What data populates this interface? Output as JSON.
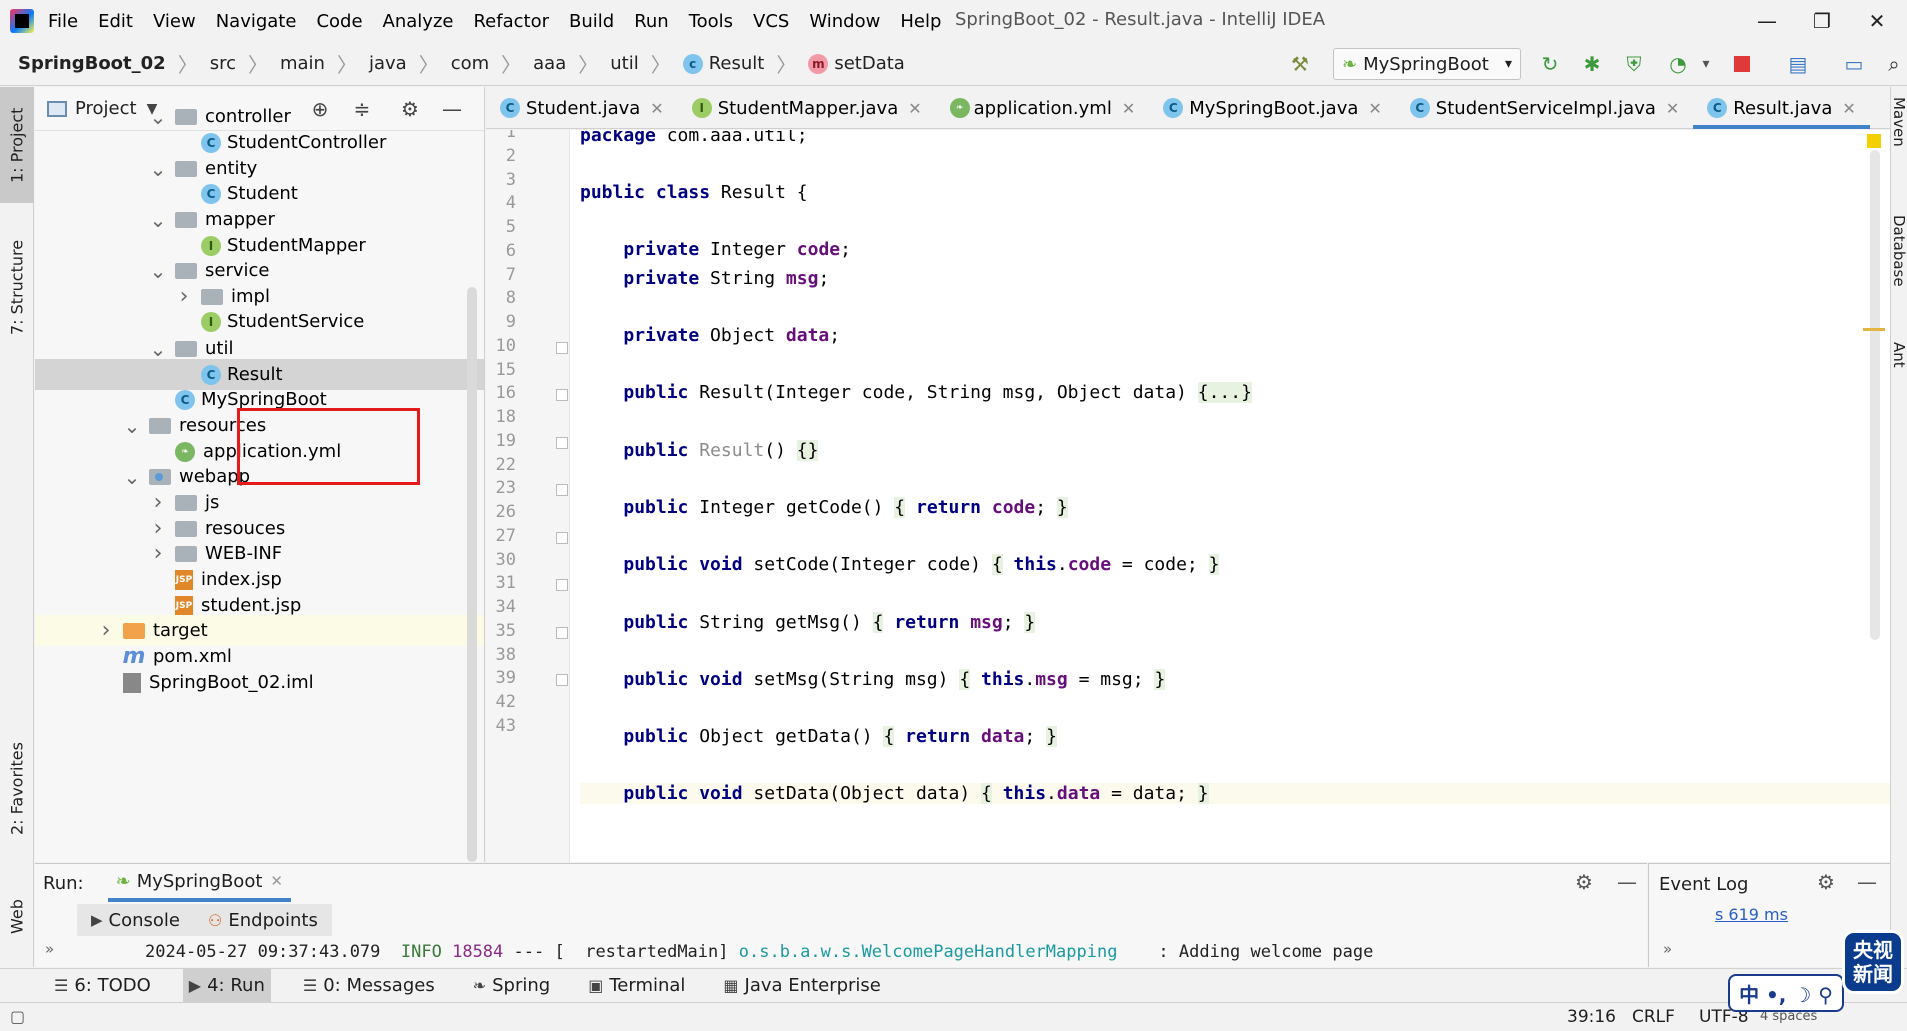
{
  "menubar": {
    "items": [
      "File",
      "Edit",
      "View",
      "Navigate",
      "Code",
      "Analyze",
      "Refactor",
      "Build",
      "Run",
      "Tools",
      "VCS",
      "Window",
      "Help"
    ],
    "window_title": "SpringBoot_02 - Result.java - IntelliJ IDEA"
  },
  "breadcrumb": {
    "items": [
      "SpringBoot_02",
      "src",
      "main",
      "java",
      "com",
      "aaa",
      "util",
      "Result",
      "setData"
    ]
  },
  "toolbar": {
    "run_config": "MySpringBoot"
  },
  "left_strip": {
    "project_tab": "1: Project",
    "structure_tab": "7: Structure",
    "favorites_tab": "2: Favorites",
    "web_tab": "Web"
  },
  "right_strip": {
    "maven_tab": "Maven",
    "database_tab": "Database",
    "ant_tab": "Ant"
  },
  "project_panel": {
    "title": "Project",
    "tree": [
      {
        "label": "controller",
        "type": "folder",
        "indent": 1,
        "arrow": "down"
      },
      {
        "label": "StudentController",
        "type": "class",
        "indent": 2,
        "arrow": ""
      },
      {
        "label": "entity",
        "type": "folder",
        "indent": 1,
        "arrow": "down"
      },
      {
        "label": "Student",
        "type": "class",
        "indent": 2,
        "arrow": ""
      },
      {
        "label": "mapper",
        "type": "folder",
        "indent": 1,
        "arrow": "down"
      },
      {
        "label": "StudentMapper",
        "type": "interface",
        "indent": 2,
        "arrow": ""
      },
      {
        "label": "service",
        "type": "folder",
        "indent": 1,
        "arrow": "down"
      },
      {
        "label": "impl",
        "type": "folder",
        "indent": 2,
        "arrow": "right"
      },
      {
        "label": "StudentService",
        "type": "interface",
        "indent": 2,
        "arrow": ""
      },
      {
        "label": "util",
        "type": "folder",
        "indent": 1,
        "arrow": "down"
      },
      {
        "label": "Result",
        "type": "class",
        "indent": 2,
        "arrow": "",
        "selected": true
      },
      {
        "label": "MySpringBoot",
        "type": "class",
        "indent": 1,
        "arrow": ""
      },
      {
        "label": "resources",
        "type": "folder",
        "indent": 0,
        "arrow": "down"
      },
      {
        "label": "application.yml",
        "type": "yml",
        "indent": 1,
        "arrow": ""
      },
      {
        "label": "webapp",
        "type": "folder-blue",
        "indent": 0,
        "arrow": "down"
      },
      {
        "label": "js",
        "type": "folder",
        "indent": 1,
        "arrow": "right"
      },
      {
        "label": "resouces",
        "type": "folder",
        "indent": 1,
        "arrow": "right"
      },
      {
        "label": "WEB-INF",
        "type": "folder",
        "indent": 1,
        "arrow": "right"
      },
      {
        "label": "index.jsp",
        "type": "jsp",
        "indent": 1,
        "arrow": ""
      },
      {
        "label": "student.jsp",
        "type": "jsp",
        "indent": 1,
        "arrow": ""
      },
      {
        "label": "target",
        "type": "folder-orange",
        "indent": -1,
        "arrow": "right",
        "yellow": true
      },
      {
        "label": "pom.xml",
        "type": "pom",
        "indent": -1,
        "arrow": ""
      },
      {
        "label": "SpringBoot_02.iml",
        "type": "iml",
        "indent": -1,
        "arrow": ""
      }
    ]
  },
  "editor_tabs": [
    {
      "label": "Student.java",
      "icon": "c"
    },
    {
      "label": "StudentMapper.java",
      "icon": "i"
    },
    {
      "label": "application.yml",
      "icon": "yml"
    },
    {
      "label": "MySpringBoot.java",
      "icon": "c"
    },
    {
      "label": "StudentServiceImpl.java",
      "icon": "c"
    },
    {
      "label": "Result.java",
      "icon": "c",
      "active": true
    }
  ],
  "editor": {
    "line_numbers": [
      "1",
      "2",
      "3",
      "4",
      "5",
      "6",
      "7",
      "8",
      "9",
      "10",
      "15",
      "16",
      "18",
      "19",
      "22",
      "23",
      "26",
      "27",
      "30",
      "31",
      "34",
      "35",
      "38",
      "39",
      "42",
      "43"
    ],
    "current_line": "39"
  },
  "run_panel": {
    "label": "Run:",
    "tab": "MySpringBoot",
    "console_tab": "Console",
    "endpoints_tab": "Endpoints",
    "console_line": {
      "timestamp": "2024-05-27 09:37:43.079",
      "level": "INFO",
      "pid": "18584",
      "sep": "--- [",
      "thread": "restartedMain]",
      "logger": "o.s.b.a.w.s.WelcomePageHandlerMapping",
      "message": ": Adding welcome page"
    }
  },
  "event_log": {
    "title": "Event Log",
    "link": "s 619 ms"
  },
  "bottom_tools": [
    {
      "label": "6: TODO",
      "icon": "☰"
    },
    {
      "label": "4: Run",
      "icon": "▶",
      "active": true
    },
    {
      "label": "0: Messages",
      "icon": "☰"
    },
    {
      "label": "Spring",
      "icon": "❧"
    },
    {
      "label": "Terminal",
      "icon": "▣"
    },
    {
      "label": "Java Enterprise",
      "icon": "▦"
    }
  ],
  "status_bar": {
    "position": "39:16",
    "line_sep": "CRLF",
    "encoding": "UTF-8",
    "indent": "4 spaces"
  },
  "watermark": {
    "logo_text": "央视新闻",
    "ime_text": "中 •, ☽ ⚲"
  }
}
